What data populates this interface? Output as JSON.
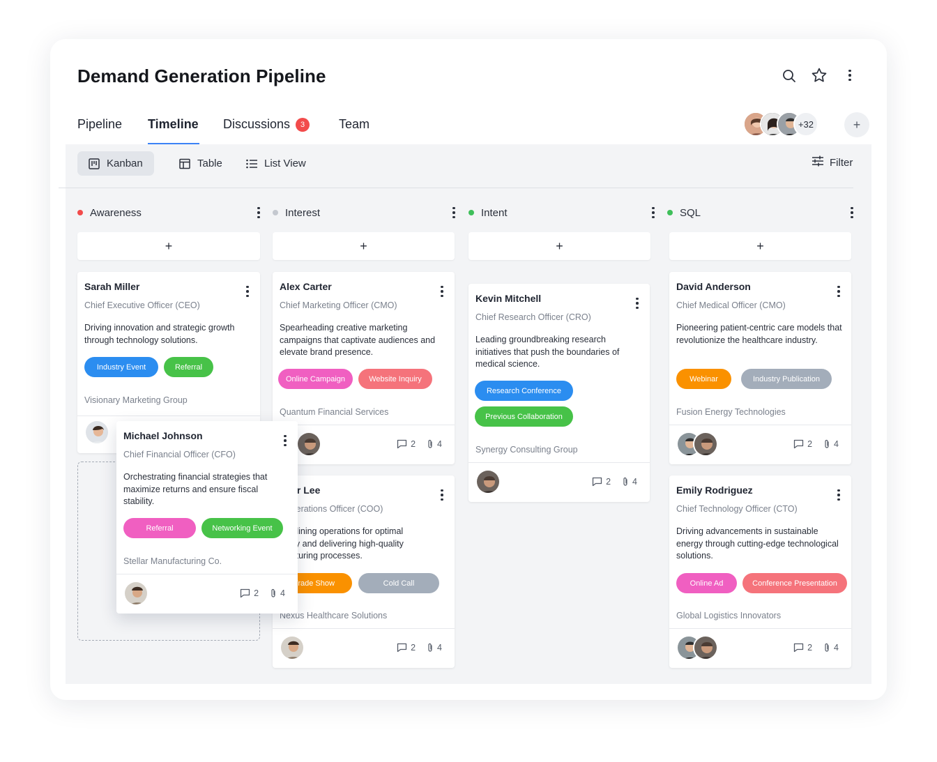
{
  "header": {
    "title": "Demand Generation Pipeline",
    "tabs": [
      {
        "label": "Pipeline"
      },
      {
        "label": "Timeline"
      },
      {
        "label": "Discussions",
        "badge": "3"
      },
      {
        "label": "Team"
      }
    ],
    "members_more": "+32",
    "add_member": "+"
  },
  "views": {
    "kanban": "Kanban",
    "table": "Table",
    "list": "List View",
    "filter": "Filter"
  },
  "columns": [
    {
      "title": "Awareness",
      "color": "#f24b4b"
    },
    {
      "title": "Interest",
      "color": "#c4c8cf"
    },
    {
      "title": "Intent",
      "color": "#3fbf5a"
    },
    {
      "title": "SQL",
      "color": "#3fbf5a"
    }
  ],
  "add_label": "+",
  "colors": {
    "blue": "#2b8df0",
    "green": "#47c248",
    "pink": "#f05fc1",
    "salmon": "#f5737b",
    "orange": "#fa9100",
    "gray": "#a3adba"
  },
  "cards": {
    "sarah": {
      "name": "Sarah Miller",
      "role": "Chief Executive Officer (CEO)",
      "desc": "Driving innovation and strategic growth through technology solutions.",
      "tags": [
        "Industry Event",
        "Referral"
      ],
      "company": "Visionary Marketing Group"
    },
    "michael": {
      "name": "Michael Johnson",
      "role": "Chief Financial Officer (CFO)",
      "desc": "Orchestrating financial strategies that maximize returns and ensure fiscal stability.",
      "tags": [
        "Referral",
        "Networking Event"
      ],
      "company": "Stellar Manufacturing Co.",
      "comments": "2",
      "attachments": "4"
    },
    "alex": {
      "name": "Alex Carter",
      "role": "Chief Marketing Officer (CMO)",
      "desc": "Spearheading creative marketing campaigns that captivate audiences and elevate brand presence.",
      "tags": [
        "Online Campaign",
        "Website Inquiry"
      ],
      "company": "Quantum Financial Services",
      "comments": "2",
      "attachments": "4"
    },
    "jennifer": {
      "name": "nifer Lee",
      "role": "f Operations Officer (COO)",
      "desc_lines": [
        "eamlining operations for optimal",
        "iency and delivering high-quality",
        "ufacturing processes."
      ],
      "tags": [
        "Trade Show",
        "Cold Call"
      ],
      "company": "Nexus Healthcare Solutions",
      "comments": "2",
      "attachments": "4"
    },
    "kevin": {
      "name": "Kevin Mitchell",
      "role": "Chief Research Officer (CRO)",
      "desc": "Leading groundbreaking research initiatives that push the boundaries of medical science.",
      "tags": [
        "Research Conference",
        "Previous Collaboration"
      ],
      "company": "Synergy Consulting Group",
      "comments": "2",
      "attachments": "4"
    },
    "david": {
      "name": "David Anderson",
      "role": "Chief Medical Officer (CMO)",
      "desc": "Pioneering patient-centric care models that revolutionize the healthcare industry.",
      "tags": [
        "Webinar",
        "Industry Publication"
      ],
      "company": "Fusion Energy Technologies",
      "comments": "2",
      "attachments": "4"
    },
    "emily": {
      "name": "Emily Rodriguez",
      "role": "Chief Technology Officer (CTO)",
      "desc": "Driving advancements in sustainable energy through cutting-edge technological solutions.",
      "tags": [
        "Online Ad",
        "Conference Presentation"
      ],
      "company": "Global Logistics Innovators",
      "comments": "2",
      "attachments": "4"
    }
  }
}
